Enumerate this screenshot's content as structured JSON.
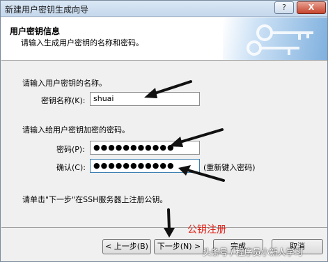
{
  "window": {
    "title": "新建用户密钥生成向导",
    "help_label": "?",
    "close_label": "X"
  },
  "header": {
    "title": "用户密钥信息",
    "subtitle": "请输入生成用户密钥的名称和密码。"
  },
  "name_section": {
    "prompt": "请输入用户密钥的名称。",
    "key_name_label": "密钥名称(K):",
    "key_name_value": "shuai"
  },
  "password_section": {
    "prompt": "请输入给用户密钥加密的密码。",
    "password_label": "密码(P):",
    "password_value": "●●●●●●●●●●●",
    "confirm_label": "确认(C):",
    "confirm_value": "●●●●●●●●●●●",
    "reenter_hint": "(重新键入密码)"
  },
  "instruction": "请单击\"下一步\"在SSH服务器上注册公钥。",
  "annotation": "公钥注册",
  "buttons": {
    "back": "< 上一步(B)",
    "next": "下一步(N) >",
    "finish": "完成",
    "cancel": "取消"
  },
  "watermark": "头条号 / 程序员小新人学习",
  "colors": {
    "annotation_red": "#e2251b",
    "focus_border": "#3c7fb1"
  }
}
